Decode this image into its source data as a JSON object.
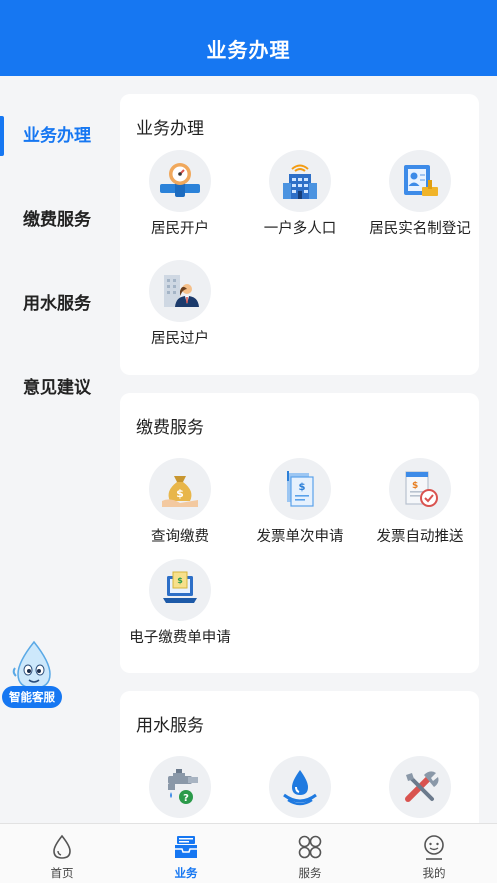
{
  "header": {
    "title": "业务办理"
  },
  "sidebar": {
    "items": [
      {
        "label": "业务办理",
        "active": true
      },
      {
        "label": "缴费服务",
        "active": false
      },
      {
        "label": "用水服务",
        "active": false
      },
      {
        "label": "意见建议",
        "active": false
      }
    ]
  },
  "sections": [
    {
      "title": "业务办理",
      "items": [
        {
          "label": "居民开户",
          "icon": "pipe-meter-icon"
        },
        {
          "label": "一户多人口",
          "icon": "apartment-building-icon"
        },
        {
          "label": "居民实名制登记",
          "icon": "id-registration-icon"
        },
        {
          "label": "居民过户",
          "icon": "ownership-transfer-icon"
        }
      ]
    },
    {
      "title": "缴费服务",
      "items": [
        {
          "label": "查询缴费",
          "icon": "money-bag-icon"
        },
        {
          "label": "发票单次申请",
          "icon": "invoice-request-icon"
        },
        {
          "label": "发票自动推送",
          "icon": "invoice-auto-push-icon"
        },
        {
          "label": "电子缴费单申请",
          "icon": "e-payment-laptop-icon"
        }
      ]
    },
    {
      "title": "用水服务",
      "items": [
        {
          "label": "",
          "icon": "water-faucet-question-icon"
        },
        {
          "label": "",
          "icon": "water-drop-icon"
        },
        {
          "label": "",
          "icon": "repair-tools-icon"
        }
      ]
    }
  ],
  "assistant": {
    "label": "智能客服",
    "icon": "water-drop-mascot-icon"
  },
  "tabbar": {
    "tabs": [
      {
        "label": "首页",
        "icon": "drop-home-icon",
        "active": false
      },
      {
        "label": "业务",
        "icon": "business-tray-icon",
        "active": true
      },
      {
        "label": "服务",
        "icon": "service-grid-icon",
        "active": false
      },
      {
        "label": "我的",
        "icon": "profile-icon",
        "active": false
      }
    ]
  },
  "colors": {
    "primary": "#1677f2",
    "background": "#f4f5f7",
    "icon_bg": "#eef0f3"
  }
}
